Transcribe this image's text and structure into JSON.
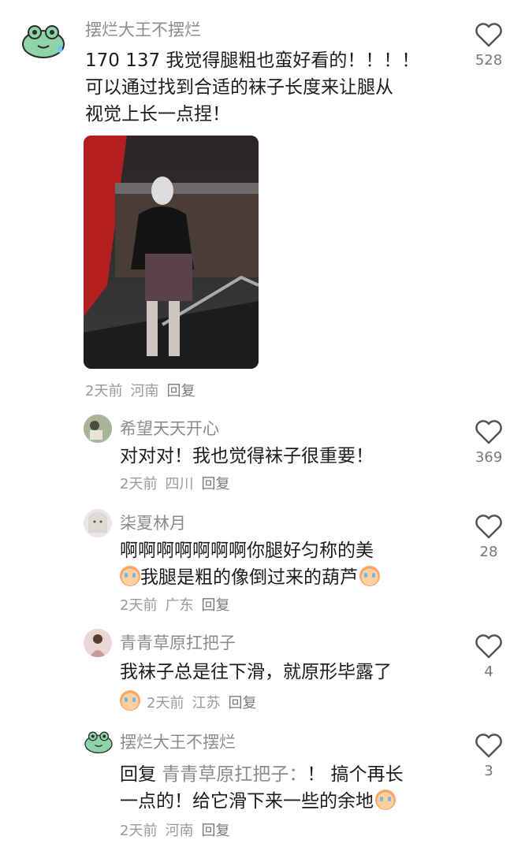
{
  "comments": [
    {
      "name": "摆烂大王不摆烂",
      "content_lines": [
        "170 137 我觉得腿粗也蛮好看的！！！！",
        "可以通过找到合适的袜子长度来让腿从",
        "视觉上长一点捏！"
      ],
      "time": "2天前",
      "location": "河南",
      "reply": "回复",
      "likes": "528"
    },
    {
      "name": "希望天天开心",
      "content_lines": [
        "对对对！我也觉得袜子很重要！"
      ],
      "time": "2天前",
      "location": "四川",
      "reply": "回复",
      "likes": "369"
    },
    {
      "name": "柒夏林月",
      "content_lines": [
        "啊啊啊啊啊啊啊你腿好匀称的美",
        "我腿是粗的像倒过来的葫芦"
      ],
      "time": "2天前",
      "location": "广东",
      "reply": "回复",
      "likes": "28"
    },
    {
      "name": "青青草原扛把子",
      "content_lines": [
        "我袜子总是往下滑，就原形毕露了"
      ],
      "time": "2天前",
      "location": "江苏",
      "reply": "回复",
      "likes": "4"
    },
    {
      "name": "摆烂大王不摆烂",
      "reply_prefix": "回复",
      "reply_target": "青青草原扛把子：",
      "content_lines": [
        "！ 搞个再长",
        "一点的！给它滑下来一些的余地"
      ],
      "time": "2天前",
      "location": "河南",
      "reply": "回复",
      "likes": "3"
    }
  ],
  "icons": {
    "like": "heart-outline-icon",
    "emoji_cry": "crying-face-emoji",
    "emoji_sad": "sad-face-emoji"
  },
  "colors": {
    "frog": "#7fcfa0",
    "name": "#8c8c8c",
    "meta": "#9a9a9a"
  }
}
